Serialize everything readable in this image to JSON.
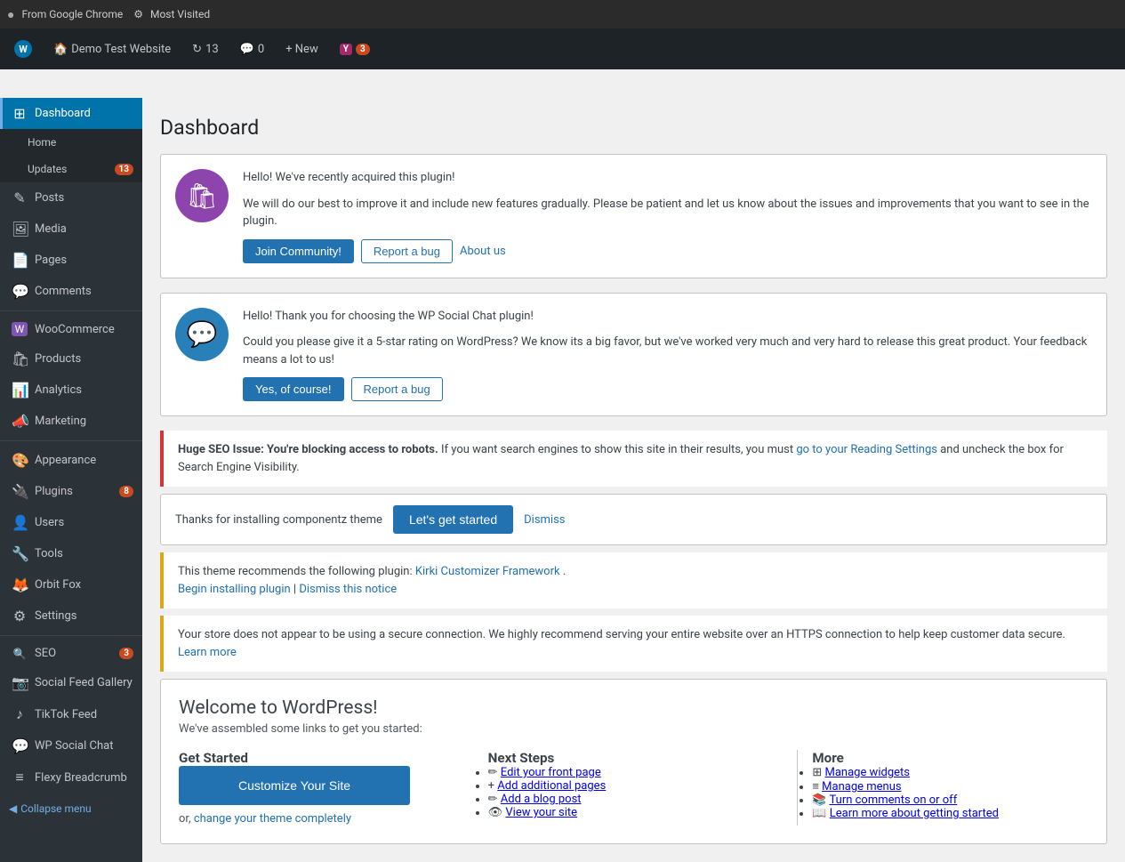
{
  "browser": {
    "bar_text": "From Google Chrome",
    "most_visited": "Most Visited"
  },
  "admin_bar": {
    "wp_logo": "W",
    "site_name": "Demo Test Website",
    "updates_icon": "↻",
    "updates_count": "13",
    "comments_icon": "💬",
    "comments_count": "0",
    "new_label": "+ New",
    "yoast_label": "Y",
    "yoast_badge": "3"
  },
  "sidebar": {
    "active_item": "Dashboard",
    "items": [
      {
        "id": "dashboard",
        "label": "Dashboard",
        "icon": "⊞",
        "active": true
      },
      {
        "id": "home",
        "label": "Home",
        "icon": ""
      },
      {
        "id": "updates",
        "label": "Updates",
        "icon": "",
        "badge": "13"
      },
      {
        "id": "posts",
        "label": "Posts",
        "icon": "✎"
      },
      {
        "id": "media",
        "label": "Media",
        "icon": "🖼"
      },
      {
        "id": "pages",
        "label": "Pages",
        "icon": "📄"
      },
      {
        "id": "comments",
        "label": "Comments",
        "icon": "💬"
      },
      {
        "id": "woocommerce",
        "label": "WooCommerce",
        "icon": "W"
      },
      {
        "id": "products",
        "label": "Products",
        "icon": "🛍"
      },
      {
        "id": "analytics",
        "label": "Analytics",
        "icon": "📊"
      },
      {
        "id": "marketing",
        "label": "Marketing",
        "icon": "📣"
      },
      {
        "id": "appearance",
        "label": "Appearance",
        "icon": "🎨"
      },
      {
        "id": "plugins",
        "label": "Plugins",
        "icon": "🔌",
        "badge": "8"
      },
      {
        "id": "users",
        "label": "Users",
        "icon": "👤"
      },
      {
        "id": "tools",
        "label": "Tools",
        "icon": "🔧"
      },
      {
        "id": "orbit-fox",
        "label": "Orbit Fox",
        "icon": "🦊"
      },
      {
        "id": "settings",
        "label": "Settings",
        "icon": "⚙"
      },
      {
        "id": "seo",
        "label": "SEO",
        "icon": "🔍",
        "badge": "3"
      },
      {
        "id": "social-feed",
        "label": "Social Feed Gallery",
        "icon": "📷"
      },
      {
        "id": "tiktok",
        "label": "TikTok Feed",
        "icon": "♪"
      },
      {
        "id": "wp-social",
        "label": "WP Social Chat",
        "icon": "💬"
      },
      {
        "id": "flexy",
        "label": "Flexy Breadcrumb",
        "icon": "≡"
      }
    ],
    "collapse_label": "Collapse menu"
  },
  "page": {
    "title": "Dashboard"
  },
  "notice1": {
    "icon": "🛍",
    "text1": "Hello! We've recently acquired this plugin!",
    "text2": "We will do our best to improve it and include new features gradually. Please be patient and let us know about the issues and improvements that you want to see in the plugin.",
    "btn1": "Join Community!",
    "btn2": "Report a bug",
    "link1": "About us"
  },
  "notice2": {
    "icon": "💬",
    "text1": "Hello! Thank you for choosing the WP Social Chat plugin!",
    "text2": "Could you please give it a 5-star rating on WordPress? We know its a big favor, but we've worked very much and very hard to release this great product. Your feedback means a lot to us!",
    "btn1": "Yes, of course!",
    "btn2": "Report a bug"
  },
  "seo_notice": {
    "text": "Huge SEO Issue: You're blocking access to robots.",
    "text2": " If you want search engines to show this site in their results, you must ",
    "link": "go to your Reading Settings",
    "text3": " and uncheck the box for Search Engine Visibility."
  },
  "theme_notice": {
    "text": "Thanks for installing componentz theme",
    "btn": "Let's get started",
    "dismiss": "Dismiss"
  },
  "plugin_notice": {
    "text1": "This theme recommends the following plugin: ",
    "plugin_name": "Kirki Customizer Framework",
    "text2": ".",
    "install_link": "Begin installing plugin",
    "dismiss_link": "Dismiss this notice"
  },
  "store_notice": {
    "text": "Your store does not appear to be using a secure connection. We highly recommend serving your entire website over an HTTPS connection to help keep customer data secure.",
    "link": "Learn more"
  },
  "welcome": {
    "title": "Welcome to WordPress!",
    "subtitle": "We've assembled some links to get you started:",
    "get_started": {
      "heading": "Get Started",
      "customize_btn": "Customize Your Site",
      "or_text": "or,",
      "theme_link": "change your theme completely"
    },
    "next_steps": {
      "heading": "Next Steps",
      "items": [
        {
          "icon": "✏",
          "label": "Edit your front page"
        },
        {
          "icon": "+",
          "label": "Add additional pages"
        },
        {
          "icon": "✏",
          "label": "Add a blog post"
        },
        {
          "icon": "👁",
          "label": "View your site"
        }
      ]
    },
    "more": {
      "heading": "More",
      "items": [
        {
          "icon": "⊞",
          "label": "M..."
        },
        {
          "icon": "≡",
          "label": "M..."
        },
        {
          "icon": "Tu",
          "label": "Tu..."
        },
        {
          "icon": "Le",
          "label": "Le..."
        }
      ]
    }
  }
}
